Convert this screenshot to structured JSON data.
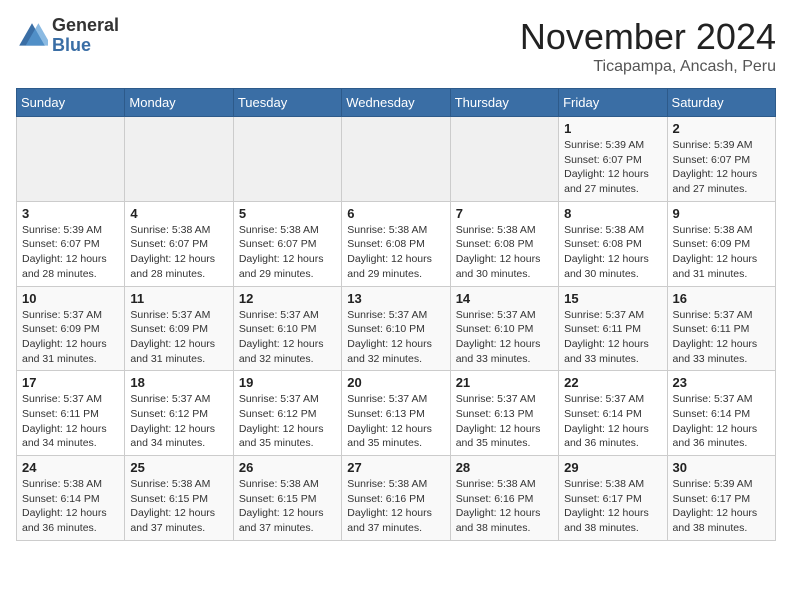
{
  "header": {
    "logo_general": "General",
    "logo_blue": "Blue",
    "month_title": "November 2024",
    "location": "Ticapampa, Ancash, Peru"
  },
  "days_of_week": [
    "Sunday",
    "Monday",
    "Tuesday",
    "Wednesday",
    "Thursday",
    "Friday",
    "Saturday"
  ],
  "weeks": [
    [
      {
        "day": "",
        "info": ""
      },
      {
        "day": "",
        "info": ""
      },
      {
        "day": "",
        "info": ""
      },
      {
        "day": "",
        "info": ""
      },
      {
        "day": "",
        "info": ""
      },
      {
        "day": "1",
        "info": "Sunrise: 5:39 AM\nSunset: 6:07 PM\nDaylight: 12 hours\nand 27 minutes."
      },
      {
        "day": "2",
        "info": "Sunrise: 5:39 AM\nSunset: 6:07 PM\nDaylight: 12 hours\nand 27 minutes."
      }
    ],
    [
      {
        "day": "3",
        "info": "Sunrise: 5:39 AM\nSunset: 6:07 PM\nDaylight: 12 hours\nand 28 minutes."
      },
      {
        "day": "4",
        "info": "Sunrise: 5:38 AM\nSunset: 6:07 PM\nDaylight: 12 hours\nand 28 minutes."
      },
      {
        "day": "5",
        "info": "Sunrise: 5:38 AM\nSunset: 6:07 PM\nDaylight: 12 hours\nand 29 minutes."
      },
      {
        "day": "6",
        "info": "Sunrise: 5:38 AM\nSunset: 6:08 PM\nDaylight: 12 hours\nand 29 minutes."
      },
      {
        "day": "7",
        "info": "Sunrise: 5:38 AM\nSunset: 6:08 PM\nDaylight: 12 hours\nand 30 minutes."
      },
      {
        "day": "8",
        "info": "Sunrise: 5:38 AM\nSunset: 6:08 PM\nDaylight: 12 hours\nand 30 minutes."
      },
      {
        "day": "9",
        "info": "Sunrise: 5:38 AM\nSunset: 6:09 PM\nDaylight: 12 hours\nand 31 minutes."
      }
    ],
    [
      {
        "day": "10",
        "info": "Sunrise: 5:37 AM\nSunset: 6:09 PM\nDaylight: 12 hours\nand 31 minutes."
      },
      {
        "day": "11",
        "info": "Sunrise: 5:37 AM\nSunset: 6:09 PM\nDaylight: 12 hours\nand 31 minutes."
      },
      {
        "day": "12",
        "info": "Sunrise: 5:37 AM\nSunset: 6:10 PM\nDaylight: 12 hours\nand 32 minutes."
      },
      {
        "day": "13",
        "info": "Sunrise: 5:37 AM\nSunset: 6:10 PM\nDaylight: 12 hours\nand 32 minutes."
      },
      {
        "day": "14",
        "info": "Sunrise: 5:37 AM\nSunset: 6:10 PM\nDaylight: 12 hours\nand 33 minutes."
      },
      {
        "day": "15",
        "info": "Sunrise: 5:37 AM\nSunset: 6:11 PM\nDaylight: 12 hours\nand 33 minutes."
      },
      {
        "day": "16",
        "info": "Sunrise: 5:37 AM\nSunset: 6:11 PM\nDaylight: 12 hours\nand 33 minutes."
      }
    ],
    [
      {
        "day": "17",
        "info": "Sunrise: 5:37 AM\nSunset: 6:11 PM\nDaylight: 12 hours\nand 34 minutes."
      },
      {
        "day": "18",
        "info": "Sunrise: 5:37 AM\nSunset: 6:12 PM\nDaylight: 12 hours\nand 34 minutes."
      },
      {
        "day": "19",
        "info": "Sunrise: 5:37 AM\nSunset: 6:12 PM\nDaylight: 12 hours\nand 35 minutes."
      },
      {
        "day": "20",
        "info": "Sunrise: 5:37 AM\nSunset: 6:13 PM\nDaylight: 12 hours\nand 35 minutes."
      },
      {
        "day": "21",
        "info": "Sunrise: 5:37 AM\nSunset: 6:13 PM\nDaylight: 12 hours\nand 35 minutes."
      },
      {
        "day": "22",
        "info": "Sunrise: 5:37 AM\nSunset: 6:14 PM\nDaylight: 12 hours\nand 36 minutes."
      },
      {
        "day": "23",
        "info": "Sunrise: 5:37 AM\nSunset: 6:14 PM\nDaylight: 12 hours\nand 36 minutes."
      }
    ],
    [
      {
        "day": "24",
        "info": "Sunrise: 5:38 AM\nSunset: 6:14 PM\nDaylight: 12 hours\nand 36 minutes."
      },
      {
        "day": "25",
        "info": "Sunrise: 5:38 AM\nSunset: 6:15 PM\nDaylight: 12 hours\nand 37 minutes."
      },
      {
        "day": "26",
        "info": "Sunrise: 5:38 AM\nSunset: 6:15 PM\nDaylight: 12 hours\nand 37 minutes."
      },
      {
        "day": "27",
        "info": "Sunrise: 5:38 AM\nSunset: 6:16 PM\nDaylight: 12 hours\nand 37 minutes."
      },
      {
        "day": "28",
        "info": "Sunrise: 5:38 AM\nSunset: 6:16 PM\nDaylight: 12 hours\nand 38 minutes."
      },
      {
        "day": "29",
        "info": "Sunrise: 5:38 AM\nSunset: 6:17 PM\nDaylight: 12 hours\nand 38 minutes."
      },
      {
        "day": "30",
        "info": "Sunrise: 5:39 AM\nSunset: 6:17 PM\nDaylight: 12 hours\nand 38 minutes."
      }
    ]
  ]
}
